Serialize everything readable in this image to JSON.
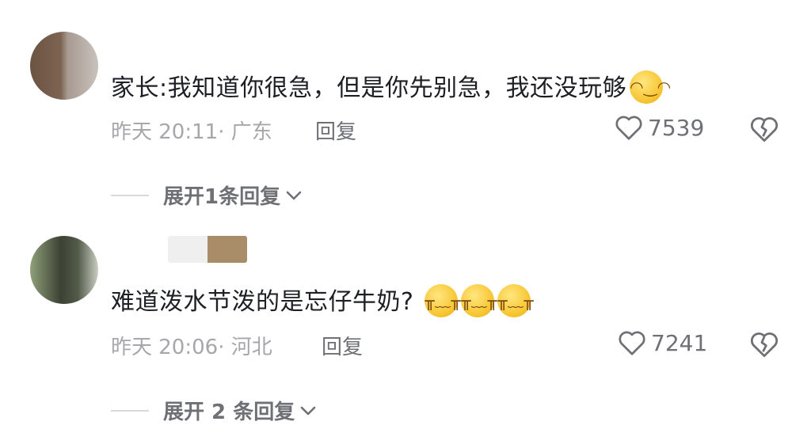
{
  "comments": [
    {
      "text": "家长:我知道你很急，但是你先别急，我还没玩够",
      "emoji_icons": [
        "grinning-face-icon"
      ],
      "time": "昨天 20:11",
      "location": "· 广东",
      "reply_label": "回复",
      "likes": "7539",
      "expand_label": "展开1条回复"
    },
    {
      "text": "难道泼水节泼的是忘仔牛奶?",
      "emoji_icons": [
        "crying-face-icon",
        "crying-face-icon",
        "crying-face-icon"
      ],
      "time": "昨天 20:06",
      "location": "· 河北",
      "reply_label": "回复",
      "likes": "7241",
      "expand_label": "展开 2 条回复"
    }
  ],
  "colors": {
    "text": "#1e1f24",
    "meta": "#a6a7ab",
    "secondary": "#6f7075",
    "divider": "#d9d9dc",
    "emoji": "#f7c531"
  }
}
